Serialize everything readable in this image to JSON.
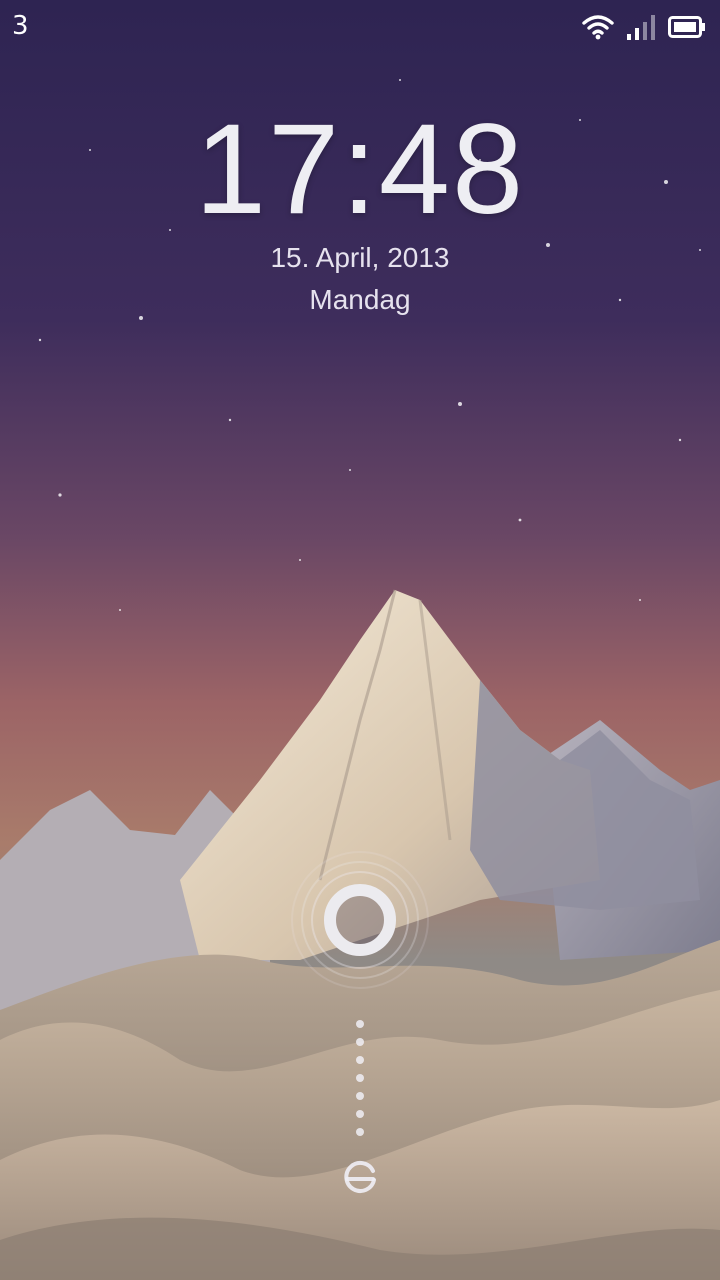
{
  "status_bar": {
    "carrier": "3",
    "icons": [
      "wifi-icon",
      "cellular-signal-icon",
      "battery-icon"
    ]
  },
  "lock_screen": {
    "time": "17:48",
    "date": "15. April, 2013",
    "weekday": "Mandag"
  },
  "unlock": {
    "handle_icon": "unlock-ring-icon",
    "target_icon": "unlock-target-icon"
  },
  "colors": {
    "sky_top": "#2e2452",
    "sky_glow": "#a86a6c",
    "text": "#eeeef3"
  }
}
